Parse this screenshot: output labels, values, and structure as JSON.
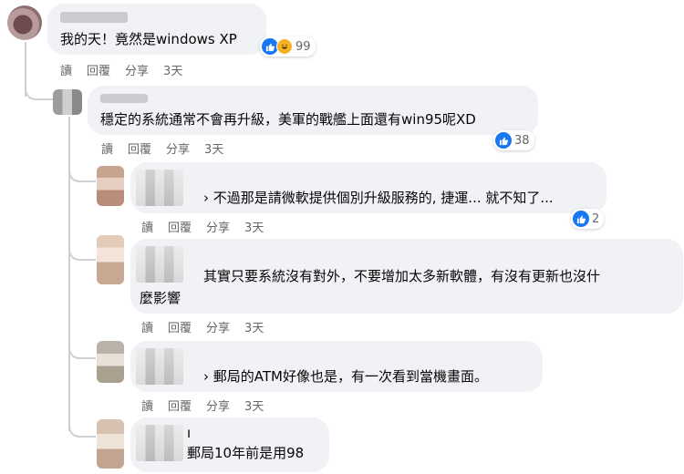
{
  "comments": [
    {
      "text_line1": "我的天！竟然是windows XP",
      "reaction_count": "99",
      "actions": [
        "讀",
        "回覆",
        "分享",
        "3天"
      ]
    },
    {
      "text_line1": "穩定的系統通常不會再升級，美軍的戰艦上面還有win95呢XD",
      "reaction_count": "38",
      "actions": [
        "讀",
        "回覆",
        "分享",
        "3天"
      ]
    },
    {
      "text_line1": "› 不過那是請微軟提供個別升級服務的, 捷運... 就不知了...",
      "reaction_count": "2",
      "actions": [
        "讀",
        "回覆",
        "分享",
        "3天"
      ]
    },
    {
      "text_line1": "其實只要系統沒有對外，不要增加太多新軟體，有沒有更新也沒什",
      "text_line2": "麼影響",
      "actions": [
        "讀",
        "回覆",
        "分享",
        "3天"
      ]
    },
    {
      "text_line1": "› 郵局的ATM好像也是，有一次看到當機畫面。",
      "actions": [
        "讀",
        "回覆",
        "分享",
        "3天"
      ]
    },
    {
      "text_line0": "ı",
      "text_line1": "郵局10年前是用98"
    }
  ],
  "colors": {
    "bubble": "#f0f2f5",
    "like_blue": "#1877f2",
    "haha_yellow": "#f7b125",
    "meta_gray": "#65676b"
  }
}
